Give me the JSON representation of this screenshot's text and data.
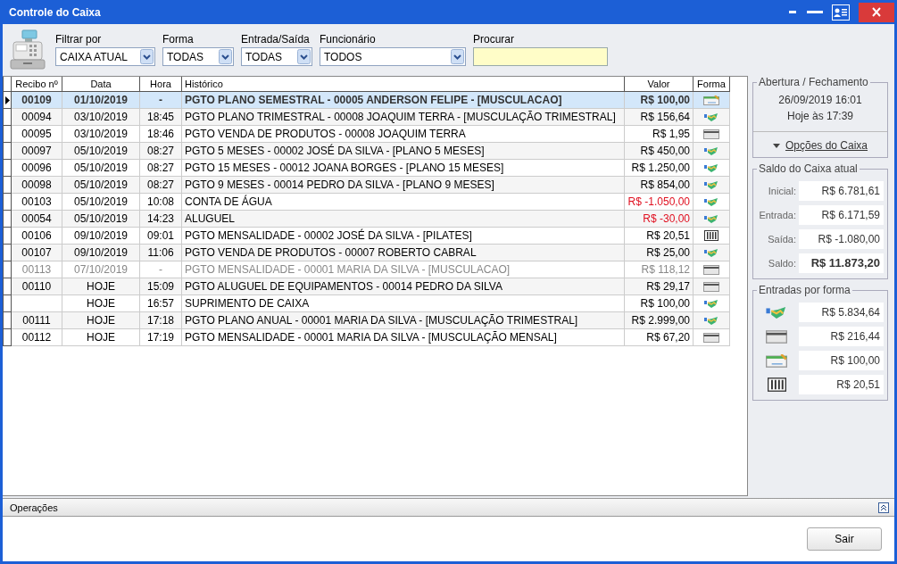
{
  "window": {
    "title": "Controle do Caixa"
  },
  "filters": [
    {
      "label": "Filtrar por",
      "value": "CAIXA ATUAL"
    },
    {
      "label": "Forma",
      "value": "TODAS"
    },
    {
      "label": "Entrada/Saída",
      "value": "TODAS"
    },
    {
      "label": "Funcionário",
      "value": "TODOS"
    }
  ],
  "search": {
    "label": "Procurar"
  },
  "table": {
    "columns": [
      "Recibo nº",
      "Data",
      "Hora",
      "Histórico",
      "Valor",
      "Forma"
    ],
    "rows": [
      {
        "recibo": "00109",
        "data": "01/10/2019",
        "hora": "-",
        "historico": "PGTO PLANO SEMESTRAL - 00005 ANDERSON FELIPE - [MUSCULACAO]",
        "valor": "R$ 100,00",
        "kind": "check",
        "selected": true,
        "negative": false,
        "greyed": false
      },
      {
        "recibo": "00094",
        "data": "03/10/2019",
        "hora": "18:45",
        "historico": "PGTO PLANO TRIMESTRAL - 00008 JOAQUIM TERRA - [MUSCULAÇÃO TRIMESTRAL]",
        "valor": "R$ 156,64",
        "kind": "cash",
        "selected": false,
        "negative": false,
        "greyed": false
      },
      {
        "recibo": "00095",
        "data": "03/10/2019",
        "hora": "18:46",
        "historico": "PGTO VENDA DE PRODUTOS - 00008 JOAQUIM TERRA",
        "valor": "R$ 1,95",
        "kind": "card",
        "selected": false,
        "negative": false,
        "greyed": false
      },
      {
        "recibo": "00097",
        "data": "05/10/2019",
        "hora": "08:27",
        "historico": "PGTO 5 MESES - 00002 JOSÉ DA SILVA - [PLANO 5 MESES]",
        "valor": "R$ 450,00",
        "kind": "cash",
        "selected": false,
        "negative": false,
        "greyed": false
      },
      {
        "recibo": "00096",
        "data": "05/10/2019",
        "hora": "08:27",
        "historico": "PGTO 15 MESES - 00012 JOANA BORGES - [PLANO 15 MESES]",
        "valor": "R$ 1.250,00",
        "kind": "cash",
        "selected": false,
        "negative": false,
        "greyed": false
      },
      {
        "recibo": "00098",
        "data": "05/10/2019",
        "hora": "08:27",
        "historico": "PGTO 9 MESES - 00014 PEDRO DA SILVA - [PLANO 9 MESES]",
        "valor": "R$ 854,00",
        "kind": "cash",
        "selected": false,
        "negative": false,
        "greyed": false
      },
      {
        "recibo": "00103",
        "data": "05/10/2019",
        "hora": "10:08",
        "historico": "CONTA DE ÁGUA",
        "valor": "R$ -1.050,00",
        "kind": "cash",
        "selected": false,
        "negative": true,
        "greyed": false
      },
      {
        "recibo": "00054",
        "data": "05/10/2019",
        "hora": "14:23",
        "historico": "ALUGUEL",
        "valor": "R$ -30,00",
        "kind": "cash",
        "selected": false,
        "negative": true,
        "greyed": false
      },
      {
        "recibo": "00106",
        "data": "09/10/2019",
        "hora": "09:01",
        "historico": "PGTO MENSALIDADE - 00002 JOSÉ DA SILVA - [PILATES]",
        "valor": "R$ 20,51",
        "kind": "boleto",
        "selected": false,
        "negative": false,
        "greyed": false
      },
      {
        "recibo": "00107",
        "data": "09/10/2019",
        "hora": "11:06",
        "historico": "PGTO VENDA DE PRODUTOS - 00007 ROBERTO CABRAL",
        "valor": "R$ 25,00",
        "kind": "cash",
        "selected": false,
        "negative": false,
        "greyed": false
      },
      {
        "recibo": "00113",
        "data": "07/10/2019",
        "hora": "-",
        "historico": "PGTO MENSALIDADE - 00001 MARIA DA SILVA - [MUSCULACAO]",
        "valor": "R$ 118,12",
        "kind": "card",
        "selected": false,
        "negative": false,
        "greyed": true
      },
      {
        "recibo": "00110",
        "data": "HOJE",
        "hora": "15:09",
        "historico": "PGTO ALUGUEL DE EQUIPAMENTOS - 00014 PEDRO DA SILVA",
        "valor": "R$ 29,17",
        "kind": "card",
        "selected": false,
        "negative": false,
        "greyed": false
      },
      {
        "data": "HOJE",
        "hora": "16:57",
        "historico": "SUPRIMENTO DE CAIXA",
        "valor": "R$ 100,00",
        "kind": "cash",
        "selected": false,
        "negative": false,
        "greyed": false
      },
      {
        "recibo": "00111",
        "data": "HOJE",
        "hora": "17:18",
        "historico": "PGTO PLANO ANUAL - 00001 MARIA DA SILVA - [MUSCULAÇÃO TRIMESTRAL]",
        "valor": "R$ 2.999,00",
        "kind": "cash",
        "selected": false,
        "negative": false,
        "greyed": false
      },
      {
        "recibo": "00112",
        "data": "HOJE",
        "hora": "17:19",
        "historico": "PGTO MENSALIDADE - 00001 MARIA DA SILVA - [MUSCULAÇÃO MENSAL]",
        "valor": "R$ 67,20",
        "kind": "card",
        "selected": false,
        "negative": false,
        "greyed": false
      }
    ]
  },
  "opening_panel": {
    "title": "Abertura / Fechamento",
    "opened": "26/09/2019 16:01",
    "closed": "Hoje às 17:39",
    "options_link": "Opções do Caixa"
  },
  "balance_panel": {
    "title": "Saldo do Caixa atual",
    "rows": [
      {
        "label": "Inicial:",
        "value": "R$ 6.781,61",
        "bold": false
      },
      {
        "label": "Entrada:",
        "value": "R$ 6.171,59",
        "bold": false
      },
      {
        "label": "Saída:",
        "value": "R$ -1.080,00",
        "bold": false
      },
      {
        "label": "Saldo:",
        "value": "R$ 11.873,20",
        "bold": true
      }
    ]
  },
  "by_method_panel": {
    "title": "Entradas por forma",
    "rows": [
      {
        "kind": "cash",
        "value": "R$ 5.834,64"
      },
      {
        "kind": "card",
        "value": "R$ 216,44"
      },
      {
        "kind": "check",
        "value": "R$ 100,00"
      },
      {
        "kind": "boleto",
        "value": "R$ 20,51"
      }
    ]
  },
  "operations": {
    "title": "Operações"
  },
  "buttons": [
    {
      "label": "Sair"
    }
  ]
}
